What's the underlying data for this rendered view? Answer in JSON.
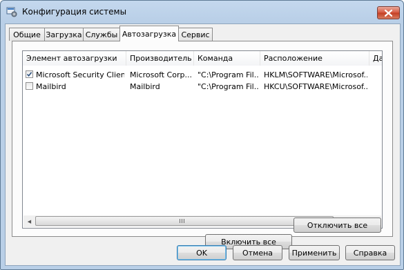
{
  "window": {
    "title": "Конфигурация системы"
  },
  "tabs": [
    {
      "label": "Общие"
    },
    {
      "label": "Загрузка"
    },
    {
      "label": "Службы"
    },
    {
      "label": "Автозагрузка",
      "selected": true
    },
    {
      "label": "Сервис"
    }
  ],
  "startup_list": {
    "columns": [
      "Элемент автозагрузки",
      "Производитель",
      "Команда",
      "Расположение",
      "Дат"
    ],
    "rows": [
      {
        "checked": true,
        "item": "Microsoft Security Client",
        "manufacturer": "Microsoft Corp...",
        "command": "\"C:\\Program Fil...",
        "location": "HKLM\\SOFTWARE\\Microsof..."
      },
      {
        "checked": false,
        "item": "Mailbird",
        "manufacturer": "Mailbird",
        "command": "\"C:\\Program Fil...",
        "location": "HKCU\\SOFTWARE\\Microsof..."
      }
    ]
  },
  "buttons": {
    "enable_all": "Включить все",
    "disable_all": "Отключить все",
    "ok": "OK",
    "cancel": "Отмена",
    "apply": "Применить",
    "help": "Справка"
  },
  "icons": {
    "app": "system-config-icon",
    "close": "close-icon",
    "check": "checkmark-icon",
    "scroll_left": "arrow-left-icon",
    "scroll_right": "arrow-right-icon"
  },
  "colors": {
    "frame": "#b9cfe7",
    "close": "#c9452c",
    "default_button": "#3c7fb1"
  }
}
